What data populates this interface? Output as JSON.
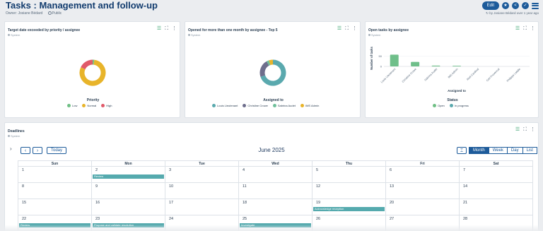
{
  "header": {
    "title": "Tasks : Management and follow-up",
    "owner_label": "Owner",
    "owner_name": "Josiane Bédard",
    "visibility": "Public",
    "edit_label": "Edit",
    "updated_text": "by Josiane Bédard over 1 year ago"
  },
  "widgets": [
    {
      "title": "Target date exceeded by priority / assignee",
      "subtitle": "System",
      "legend_title": "Priority",
      "legend": [
        {
          "label": "Low",
          "color": "#6fbf85"
        },
        {
          "label": "Normal",
          "color": "#e8b42a"
        },
        {
          "label": "High",
          "color": "#e05a6a"
        }
      ]
    },
    {
      "title": "Opened for more than one month by assignee - Top 5",
      "subtitle": "System",
      "legend_title": "Assigned to",
      "legend": [
        {
          "label": "Louis Lieutenant",
          "color": "#5aa9ae"
        },
        {
          "label": "Christine Crowe",
          "color": "#6e6e8c"
        },
        {
          "label": "Sabrina Audet",
          "color": "#6fbf9a"
        },
        {
          "label": "IMS Admin",
          "color": "#e8b42a"
        }
      ]
    },
    {
      "title": "Open tasks by assignee",
      "subtitle": "System",
      "legend_title": "Status",
      "legend": [
        {
          "label": "Open",
          "color": "#6fbf85"
        },
        {
          "label": "In progress",
          "color": "#5aa9ae"
        }
      ]
    }
  ],
  "chart_data": [
    {
      "type": "pie",
      "title": "Target date exceeded by priority / assignee",
      "labels": [
        "Low",
        "Normal",
        "High"
      ],
      "values": [
        2,
        80,
        18
      ],
      "colors": [
        "#6fbf85",
        "#e8b42a",
        "#e05a6a"
      ]
    },
    {
      "type": "pie",
      "title": "Opened for more than one month by assignee - Top 5",
      "labels": [
        "Louis Lieutenant",
        "Christine Crowe",
        "Sabrina Audet",
        "IMS Admin"
      ],
      "values": [
        70,
        22,
        3,
        5
      ],
      "colors": [
        "#5aa9ae",
        "#6e6e8c",
        "#6fbf9a",
        "#e8b42a"
      ]
    },
    {
      "type": "bar",
      "title": "Open tasks by assignee",
      "xlabel": "Assigned to",
      "ylabel": "Number of tasks",
      "categories": [
        "Louis Lieutenant",
        "Christine Crowe",
        "Sabrina Audet",
        "IMS Admin",
        "Abel Cardinal",
        "Carl Provencal",
        "Philippe Lafalle"
      ],
      "values": [
        58,
        22,
        4,
        3,
        0,
        0,
        0
      ],
      "ylim": [
        0,
        80
      ],
      "yticks": [
        0,
        50
      ]
    }
  ],
  "deadlines": {
    "title": "Deadlines",
    "subtitle": "System",
    "today_label": "Today",
    "month_label": "June 2025",
    "views": [
      "Month",
      "Week",
      "Day",
      "List"
    ],
    "weekdays": [
      "Sun",
      "Mon",
      "Tue",
      "Wed",
      "Thu",
      "Fri",
      "Sat"
    ],
    "weeks": [
      [
        {
          "d": "1"
        },
        {
          "d": "2",
          "e": "Review"
        },
        {
          "d": "3"
        },
        {
          "d": "4"
        },
        {
          "d": "5"
        },
        {
          "d": "6"
        },
        {
          "d": "7"
        }
      ],
      [
        {
          "d": "8"
        },
        {
          "d": "9"
        },
        {
          "d": "10"
        },
        {
          "d": "11"
        },
        {
          "d": "12"
        },
        {
          "d": "13"
        },
        {
          "d": "14"
        }
      ],
      [
        {
          "d": "15"
        },
        {
          "d": "16"
        },
        {
          "d": "17"
        },
        {
          "d": "18"
        },
        {
          "d": "19",
          "e": "Acknowledge reception"
        },
        {
          "d": "20"
        },
        {
          "d": "21"
        }
      ],
      [
        {
          "d": "22",
          "e": "Review"
        },
        {
          "d": "23",
          "e": "Propose and validate resolution"
        },
        {
          "d": "24"
        },
        {
          "d": "25",
          "e": "Investigate"
        },
        {
          "d": "26"
        },
        {
          "d": "27"
        },
        {
          "d": "28"
        }
      ]
    ]
  }
}
